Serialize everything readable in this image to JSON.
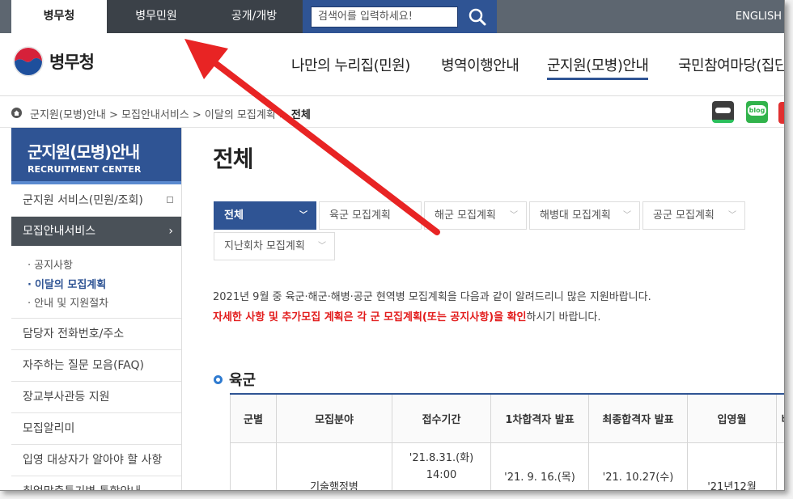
{
  "topbar": {
    "tabs": [
      "병무청",
      "병무민원",
      "공개/개방"
    ],
    "search_placeholder": "검색어를 입력하세요!",
    "english": "ENGLISH"
  },
  "header": {
    "logo_text": "병무청",
    "nav": [
      "나만의 누리집(민원)",
      "병역이행안내",
      "군지원(모병)안내",
      "국민참여마당(집단"
    ]
  },
  "breadcrumb": {
    "path": "군지원(모병)안내 > 모집안내서비스 > 이달의 모집계획 > ",
    "current": "전체"
  },
  "sns": {
    "blog": "blog"
  },
  "sidebar": {
    "title": "군지원(모병)안내",
    "subtitle": "RECRUITMENT CENTER",
    "service": "군지원 서비스(민원/조회)",
    "active": "모집안내서비스",
    "active_arrow": "›",
    "sub_items": [
      "공지사항",
      "이달의 모집계획",
      "안내 및 지원절차"
    ],
    "items": [
      "담당자 전화번호/주소",
      "자주하는 질문 모음(FAQ)",
      "장교부사관등 지원",
      "모집알리미",
      "입영 대상자가 알아야 할 사항",
      "취업맞춤특기병 통합안내"
    ]
  },
  "content": {
    "title": "전체",
    "tabs": [
      "전체",
      "육군 모집계획",
      "해군 모집계획",
      "해병대 모집계획",
      "공군 모집계획",
      "지난회차 모집계획"
    ],
    "desc1": "2021년 9월 중 육군·해군·해병·공군 현역병 모집계획을 다음과 같이 알려드리니 많은 지원바랍니다.",
    "desc2_red": "자세한 사항 및 추가모집 계획은 각 군 모집계획(또는 공지사항)을 확인",
    "desc2_rest": "하시기 바랍니다.",
    "section_title": "육군",
    "table": {
      "headers": [
        "군별",
        "모집분야",
        "접수기간",
        "1차합격자 발표",
        "최종합격자 발표",
        "입영월",
        "비"
      ],
      "row": {
        "field": "기술행정병",
        "period_l1": "'21.8.31.(화)",
        "period_l2": "14:00",
        "first": "'21. 9. 16.(목)",
        "final": "'21. 10.27(수)",
        "enlist": "'21년12월"
      }
    }
  },
  "colors": {
    "brand": "#2f5494",
    "alert": "#e21b1b",
    "arrow": "#e82424"
  }
}
